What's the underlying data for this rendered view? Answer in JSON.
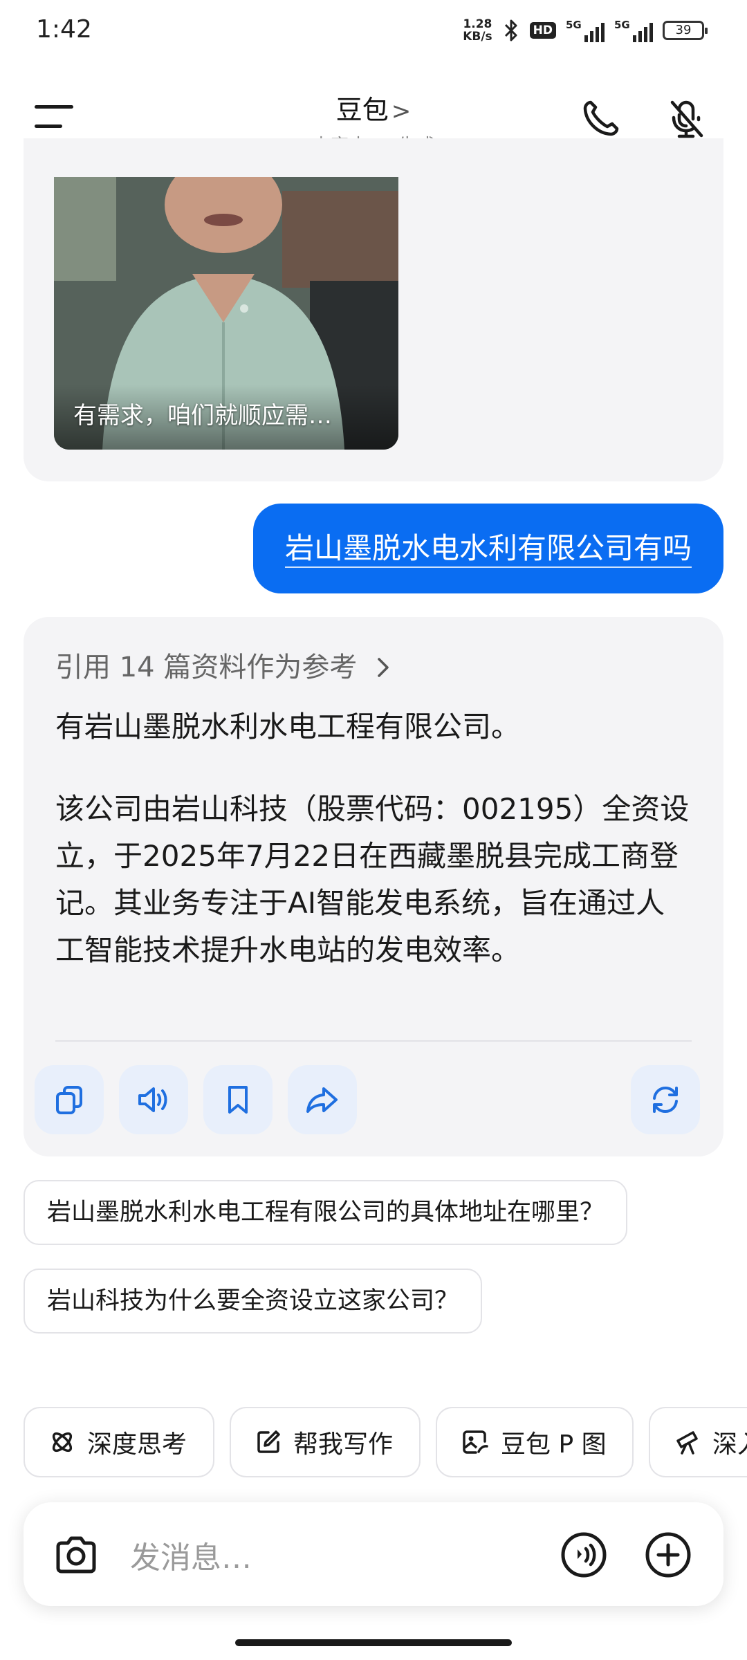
{
  "status_bar": {
    "time": "1:42",
    "net_speed_value": "1.28",
    "net_speed_unit": "KB/s",
    "hd_label": "HD",
    "signal_1_label": "5G",
    "signal_2_label": "5G",
    "battery": "39"
  },
  "header": {
    "title": "豆包",
    "title_chevron": ">",
    "subtitle": "内容由 AI 生成",
    "icons": [
      "menu-icon",
      "phone-icon",
      "mute-icon"
    ]
  },
  "chat": {
    "video_caption": "有需求，咱们就顺应需…",
    "user_message": "岩山墨脱水电水利有限公司有吗",
    "reference_line": "引用 14 篇资料作为参考",
    "answer_paragraphs": [
      "有岩山墨脱水利水电工程有限公司。",
      "该公司由岩山科技（股票代码：002195）全资设立，于2025年7月22日在西藏墨脱县完成工商登记。其业务专注于AI智能发电系统，旨在通过人工智能技术提升水电站的发电效率。"
    ],
    "answer_actions": [
      "copy-icon",
      "speaker-icon",
      "bookmark-icon",
      "share-icon",
      "regenerate-icon"
    ],
    "suggestions": [
      "岩山墨脱水利水电工程有限公司的具体地址在哪里？",
      "岩山科技为什么要全资设立这家公司？"
    ]
  },
  "tools": [
    {
      "label": "深度思考",
      "icon": "atom-icon"
    },
    {
      "label": "帮我写作",
      "icon": "edit-icon"
    },
    {
      "label": "豆包 P 图",
      "icon": "image-edit-icon"
    },
    {
      "label": "深入研究",
      "icon": "telescope-icon"
    }
  ],
  "input_bar": {
    "placeholder": "发消息…",
    "icons": [
      "camera-icon",
      "voice-icon",
      "add-icon"
    ]
  },
  "colors": {
    "accent": "#0a6df2",
    "card_bg": "#f4f4f6",
    "action_bg": "#e8effb",
    "muted_text": "#8a8a8a"
  }
}
